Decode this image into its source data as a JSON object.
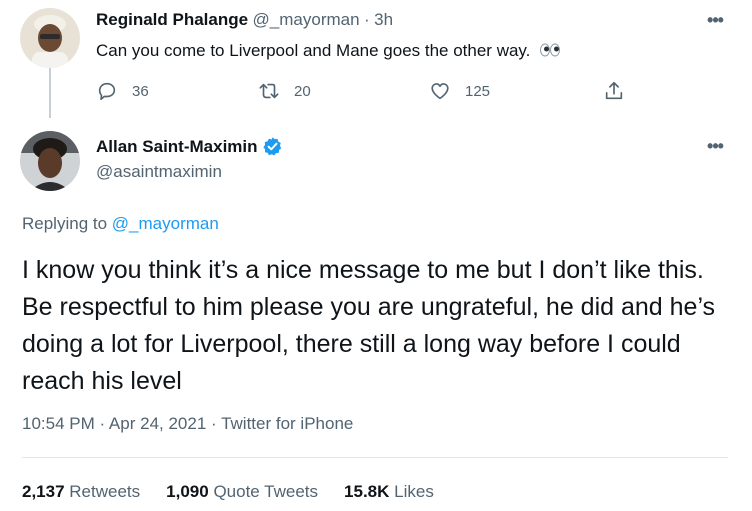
{
  "reply_context_tweet": {
    "display_name": "Reginald Phalange",
    "handle": "@_mayorman",
    "separator": "·",
    "time": "3h",
    "text": "Can you come to Liverpool and Mane goes the other way.",
    "emoji_icon": "eyes-icon",
    "actions": {
      "reply_count": "36",
      "retweet_count": "20",
      "like_count": "125"
    },
    "more_icon": "more-dots-icon"
  },
  "main_tweet": {
    "display_name": "Allan Saint-Maximin",
    "handle": "@asaintmaximin",
    "verified_icon": "verified-badge-icon",
    "replying_to_prefix": "Replying to",
    "replying_to_handle": "@_mayorman",
    "text": "I know you think it’s a nice message to me but I don’t like this. Be respectful to him please you are ungrateful, he did and he’s doing a lot for Liverpool, there still a long way before I could reach his level",
    "timestamp": "10:54 PM · Apr 24, 2021 · Twitter for iPhone",
    "stats": {
      "retweets_count": "2,137",
      "retweets_label": "Retweets",
      "quote_count": "1,090",
      "quote_label": "Quote Tweets",
      "likes_count": "15.8K",
      "likes_label": "Likes"
    }
  },
  "colors": {
    "accent": "#1d9bf0",
    "secondary_text": "#536471",
    "primary_text": "#0f1419"
  }
}
